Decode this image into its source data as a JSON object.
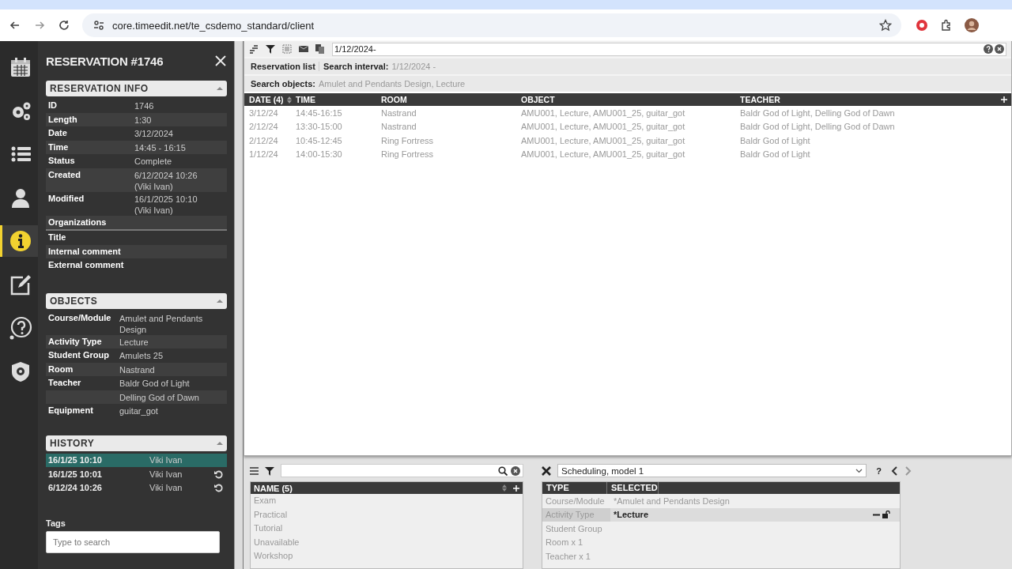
{
  "browser": {
    "url": "core.timeedit.net/te_csdemo_standard/client"
  },
  "nav_icons": [
    {
      "kind": "calendar",
      "selected": false
    },
    {
      "kind": "gears",
      "selected": false
    },
    {
      "kind": "list",
      "selected": false
    },
    {
      "kind": "person",
      "selected": false
    },
    {
      "kind": "info",
      "selected": true
    },
    {
      "kind": "edit",
      "selected": false
    },
    {
      "kind": "help",
      "selected": false
    },
    {
      "kind": "shield",
      "selected": false
    }
  ],
  "panel": {
    "title": "RESERVATION #1746",
    "reservation_info": {
      "title": "RESERVATION INFO",
      "rows": [
        {
          "label": "ID",
          "value": "1746"
        },
        {
          "label": "Length",
          "value": "1:30"
        },
        {
          "label": "Date",
          "value": "3/12/2024"
        },
        {
          "label": "Time",
          "value": "14:45 - 16:15"
        },
        {
          "label": "Status",
          "value": "Complete"
        },
        {
          "label": "Created",
          "value": "6/12/2024 10:26",
          "note": "(Viki Ivan)"
        },
        {
          "label": "Modified",
          "value": "16/1/2025 10:10",
          "note": "(Viki Ivan)"
        },
        {
          "label": "Organizations"
        },
        {
          "label": "Title"
        },
        {
          "label": "Internal comment"
        },
        {
          "label": "External comment"
        }
      ]
    },
    "objects": {
      "title": "OBJECTS",
      "rows": [
        {
          "label": "Course/Module",
          "value": "Amulet and Pendants Design"
        },
        {
          "label": "Activity Type",
          "value": "Lecture"
        },
        {
          "label": "Student Group",
          "value": "Amulets 25"
        },
        {
          "label": "Room",
          "value": "Nastrand"
        },
        {
          "label": "Teacher",
          "value": "Baldr God of Light"
        },
        {
          "value": "Delling God of Dawn"
        },
        {
          "label": "Equipment",
          "value": "guitar_got"
        }
      ]
    },
    "history": {
      "title": "HISTORY",
      "rows": [
        {
          "time": "16/1/25 10:10",
          "user": "Viki Ivan",
          "selected": true,
          "revertable": false
        },
        {
          "time": "16/1/25 10:01",
          "user": "Viki Ivan",
          "selected": false,
          "revertable": true
        },
        {
          "time": "6/12/24 10:26",
          "user": "Viki Ivan",
          "selected": false,
          "revertable": true
        }
      ]
    },
    "tags": {
      "label": "Tags",
      "placeholder": "Type to search"
    }
  },
  "main": {
    "interval_field": "1/12/2024-",
    "reservation_list": "Reservation list",
    "search_interval": {
      "label": "Search interval:",
      "value": "1/12/2024 -"
    },
    "search_objects": {
      "label": "Search objects:",
      "value": "Amulet and Pendants Design, Lecture"
    },
    "table": {
      "columns": [
        "DATE (4)",
        "TIME",
        "ROOM",
        "OBJECT",
        "TEACHER"
      ],
      "rows": [
        [
          "3/12/24",
          "14:45-16:15",
          "Nastrand",
          "AMU001, Lecture, AMU001_25, guitar_got",
          "Baldr God of Light, Delling God of Dawn"
        ],
        [
          "2/12/24",
          "13:30-15:00",
          "Nastrand",
          "AMU001, Lecture, AMU001_25, guitar_got",
          "Baldr God of Light, Delling God of Dawn"
        ],
        [
          "2/12/24",
          "10:45-12:45",
          "Ring Fortress",
          "AMU001, Lecture, AMU001_25, guitar_got",
          "Baldr God of Light"
        ],
        [
          "1/12/24",
          "14:00-15:30",
          "Ring Fortress",
          "AMU001, Lecture, AMU001_25, guitar_got",
          "Baldr God of Light"
        ]
      ]
    }
  },
  "object_list": {
    "column": "NAME (5)",
    "items": [
      "Exam",
      "Practical",
      "Tutorial",
      "Unavailable",
      "Workshop"
    ]
  },
  "scheduling": {
    "model": "Scheduling, model 1",
    "help": "?",
    "columns": [
      "TYPE",
      "SELECTED"
    ],
    "rows": [
      {
        "type": "Course/Module",
        "value": "*Amulet and Pendants Design",
        "selected": false
      },
      {
        "type": "Activity Type",
        "value": "*Lecture",
        "selected": true
      },
      {
        "type": "Student Group",
        "selected": false
      },
      {
        "type": "Room x 1",
        "selected": false
      },
      {
        "type": "Teacher x 1",
        "selected": false
      }
    ]
  }
}
